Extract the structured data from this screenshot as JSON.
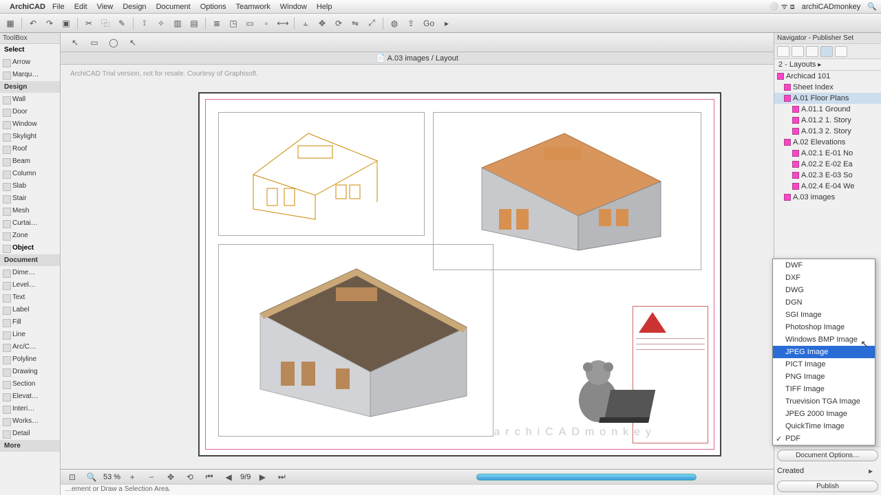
{
  "menubar": {
    "app": "ArchiCAD",
    "items": [
      "File",
      "Edit",
      "View",
      "Design",
      "Document",
      "Options",
      "Teamwork",
      "Window",
      "Help"
    ],
    "account": "archiCADmonkey"
  },
  "toolbox": {
    "header": "ToolBox",
    "select": "Select",
    "arrow": "Arrow",
    "marquee": "Marqu…",
    "design_header": "Design",
    "design": [
      "Wall",
      "Door",
      "Window",
      "Skylight",
      "Roof",
      "Beam",
      "Column",
      "Slab",
      "Stair",
      "Mesh",
      "Curtai…",
      "Zone",
      "Object"
    ],
    "document_header": "Document",
    "document": [
      "Dime…",
      "Level…",
      "Text",
      "Label",
      "Fill",
      "Line",
      "Arc/C…",
      "Polyline",
      "Drawing",
      "Section",
      "Elevat…",
      "Interi…",
      "Works…",
      "Detail"
    ],
    "more": "More"
  },
  "doc": {
    "title": "A.03 images / Layout",
    "watermark": "ArchiCAD Trial version, not for resale. Courtesy of Graphisoft."
  },
  "status": {
    "zoom": "53 %",
    "page": "9/9",
    "hint": "…ement or Draw a Selection Area."
  },
  "navigator": {
    "title": "Navigator - Publisher Set",
    "set": "2 - Layouts",
    "tree": [
      {
        "label": "Archicad 101",
        "lvl": 0
      },
      {
        "label": "Sheet Index",
        "lvl": 1
      },
      {
        "label": "A.01 Floor Plans",
        "lvl": 1,
        "sel": true
      },
      {
        "label": "A.01.1 Ground",
        "lvl": 2
      },
      {
        "label": "A.01.2 1. Story",
        "lvl": 2
      },
      {
        "label": "A.01.3 2. Story",
        "lvl": 2
      },
      {
        "label": "A.02 Elevations",
        "lvl": 1
      },
      {
        "label": "A.02.1 E-01 No",
        "lvl": 2
      },
      {
        "label": "A.02.2 E-02 Ea",
        "lvl": 2
      },
      {
        "label": "A.02.3 E-03 So",
        "lvl": 2
      },
      {
        "label": "A.02.4 E-04 We",
        "lvl": 2
      },
      {
        "label": "A.03 images",
        "lvl": 1
      }
    ],
    "doc_options": "Document Options…",
    "created": "Created",
    "publish": "Publish"
  },
  "format_menu": {
    "items": [
      "DWF",
      "DXF",
      "DWG",
      "DGN",
      "SGI Image",
      "Photoshop Image",
      "Windows BMP Image",
      "JPEG Image",
      "PICT Image",
      "PNG Image",
      "TIFF Image",
      "Truevision TGA Image",
      "JPEG 2000 Image",
      "QuickTime Image",
      "PDF"
    ],
    "selected": "JPEG Image",
    "checked": "PDF"
  },
  "brand": "archiCADmonkey"
}
